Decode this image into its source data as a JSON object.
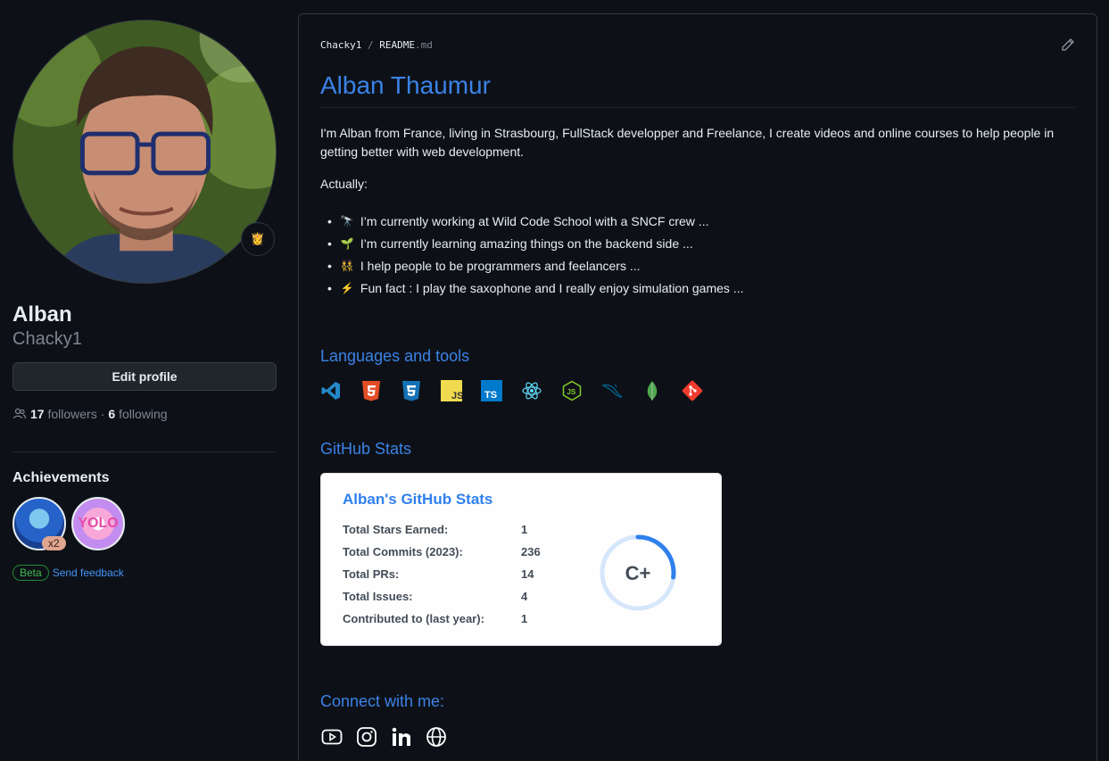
{
  "profile": {
    "name": "Alban",
    "login": "Chacky1",
    "status_emoji": "👸",
    "edit_label": "Edit profile",
    "followers_count": "17",
    "followers_label": "followers",
    "following_count": "6",
    "following_label": "following",
    "separator": "·"
  },
  "achievements": {
    "title": "Achievements",
    "badges": [
      {
        "name": "Shark badge",
        "multiplier": "x2"
      },
      {
        "name": "YOLO badge",
        "text": "YOLO"
      }
    ],
    "beta_label": "Beta",
    "feedback_label": "Send feedback"
  },
  "readme": {
    "crumb_user": "Chacky1",
    "crumb_sep": "/",
    "crumb_file": "README",
    "crumb_ext": ".md",
    "title": "Alban Thaumur",
    "intro": "I'm Alban from France, living in Strasbourg, FullStack developper and Freelance, I create videos and online courses to help people in getting better with web development.",
    "actually": "Actually:",
    "items": [
      {
        "emoji": "🔭",
        "text": "I’m currently working at Wild Code School with a SNCF crew ..."
      },
      {
        "emoji": "🌱",
        "text": "I’m currently learning amazing things on the backend side ..."
      },
      {
        "emoji": "👯",
        "text": "I help people to be programmers and feelancers ..."
      },
      {
        "emoji": "⚡",
        "text": "Fun fact : I play the saxophone and I really enjoy simulation games ..."
      }
    ],
    "tools_heading": "Languages and tools",
    "tools": [
      "vscode-icon",
      "html5-icon",
      "css3-icon",
      "javascript-icon",
      "typescript-icon",
      "react-icon",
      "nodejs-icon",
      "mysql-icon",
      "mongodb-icon",
      "git-icon"
    ],
    "stats_heading": "GitHub Stats",
    "connect_heading": "Connect with me:"
  },
  "stats_card": {
    "title": "Alban's GitHub Stats",
    "rows": [
      {
        "label": "Total Stars Earned:",
        "value": "1"
      },
      {
        "label": "Total Commits (2023):",
        "value": "236"
      },
      {
        "label": "Total PRs:",
        "value": "14"
      },
      {
        "label": "Total Issues:",
        "value": "4"
      },
      {
        "label": "Contributed to (last year):",
        "value": "1"
      }
    ],
    "rank": "C+",
    "rank_progress": 0.27,
    "colors": {
      "title": "#2f80ed",
      "text": "#434d58",
      "ring": "#2f80ed"
    }
  },
  "colors": {
    "accent": "#3b82e6",
    "background": "#0d1117"
  }
}
